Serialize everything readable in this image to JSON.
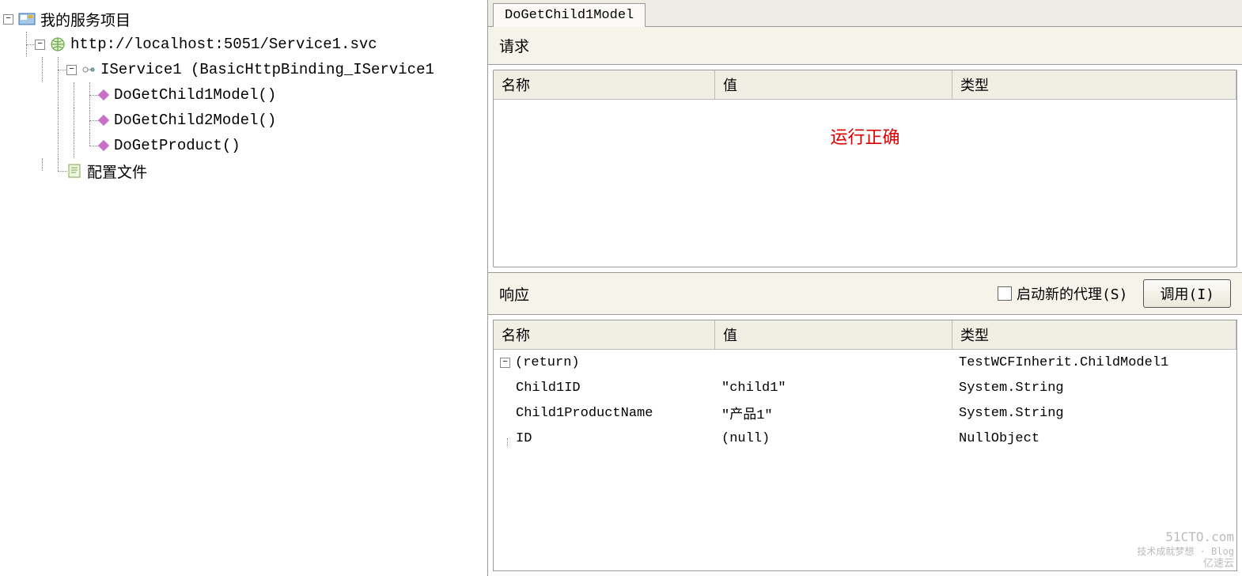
{
  "tree": {
    "root_label": "我的服务项目",
    "service_url": "http://localhost:5051/Service1.svc",
    "binding_label": "IService1 (BasicHttpBinding_IService1",
    "methods": [
      "DoGetChild1Model()",
      "DoGetChild2Model()",
      "DoGetProduct()"
    ],
    "config_label": "配置文件"
  },
  "tab": {
    "active": "DoGetChild1Model"
  },
  "request": {
    "section_label": "请求",
    "headers": {
      "name": "名称",
      "value": "值",
      "type": "类型"
    },
    "status_text": "运行正确"
  },
  "response": {
    "section_label": "响应",
    "checkbox_label": "启动新的代理(S)",
    "invoke_label": "调用(I)",
    "headers": {
      "name": "名称",
      "value": "值",
      "type": "类型"
    },
    "rows": [
      {
        "name": "(return)",
        "value": "",
        "type": "TestWCFInherit.ChildModel1",
        "expandable": true,
        "indent": 0
      },
      {
        "name": "Child1ID",
        "value": "\"child1\"",
        "type": "System.String",
        "expandable": false,
        "indent": 1
      },
      {
        "name": "Child1ProductName",
        "value": "\"产品1\"",
        "type": "System.String",
        "expandable": false,
        "indent": 1
      },
      {
        "name": "ID",
        "value": "(null)",
        "type": "NullObject",
        "expandable": false,
        "indent": 1
      }
    ]
  },
  "watermark": {
    "line1": "51CTO.com",
    "line2": "技术成就梦想 · Blog",
    "line3": "亿速云"
  }
}
